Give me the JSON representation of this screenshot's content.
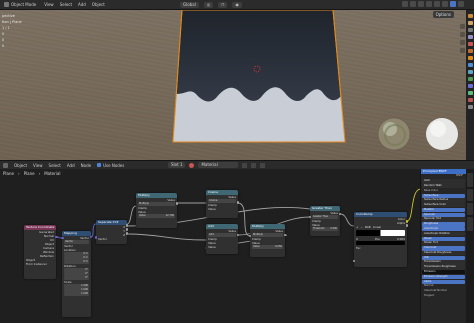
{
  "viewport_header": {
    "mode": "Object Mode",
    "menu": [
      "View",
      "Select",
      "Add",
      "Object"
    ],
    "orientation": "Global"
  },
  "viewport": {
    "overlay_lines": [
      "pective",
      "tion | Plane",
      "",
      "1 / 1",
      "0",
      "0",
      "0"
    ],
    "options_label": "Options"
  },
  "node_header": {
    "editor": "Object",
    "menu": [
      "View",
      "Select",
      "Add",
      "Node"
    ],
    "use_nodes_label": "Use Nodes",
    "slot": "Slot 1",
    "material": "Material"
  },
  "breadcrumb": [
    "Plane",
    "Plane",
    "Material"
  ],
  "nodes": {
    "texcoord": {
      "title": "Texture Coordinate",
      "outputs": [
        "Generated",
        "Normal",
        "UV",
        "Object",
        "Camera",
        "Window",
        "Reflection"
      ],
      "object_label": "Object",
      "from_instancer": "From Instancer"
    },
    "mapping": {
      "title": "Mapping",
      "type": "Vector",
      "vector": "Vector",
      "rows": [
        "Location",
        "X",
        "Y",
        "Z",
        "Rotation",
        "X",
        "Y",
        "Z",
        "Scale",
        "X",
        "Y",
        "Z"
      ],
      "loc_values": [
        "0 m",
        "0 m",
        "0 m"
      ],
      "rot_values": [
        "0°",
        "0°",
        "0°"
      ],
      "scale_values": [
        "1.000",
        "1.000",
        "1.000"
      ]
    },
    "separate": {
      "title": "Separate XYZ",
      "outputs": [
        "X",
        "Y",
        "Z"
      ],
      "input": "Vector"
    },
    "multiply1": {
      "title": "Multiply",
      "output": "Value",
      "op": "Multiply",
      "clamp": "Clamp",
      "value_label": "Value",
      "value": "12.700"
    },
    "cosine": {
      "title": "Cosine",
      "output": "Value",
      "op": "Cosine",
      "clamp": "Clamp",
      "value_label": "Value"
    },
    "add": {
      "title": "Add",
      "output": "Value",
      "op": "Add",
      "clamp": "Clamp",
      "value_label": "Value"
    },
    "multiply2": {
      "title": "Multiply",
      "output": "Value",
      "op": "Multiply",
      "clamp": "Clamp",
      "value_label": "Value",
      "value": "0.050"
    },
    "greater": {
      "title": "Greater Than",
      "output": "Value",
      "op": "Greater Than",
      "clamp": "Clamp",
      "value_label": "Value",
      "threshold": "Threshold",
      "threshold_value": "0.500"
    },
    "colorramp": {
      "title": "ColorRamp",
      "outputs": [
        "Color",
        "Alpha"
      ],
      "rgb": "RGB",
      "interp": "Linear",
      "pos_label": "Pos",
      "pos_value": "0.000",
      "index": "0",
      "input": "Fac"
    },
    "principled": {
      "title": "Principled BSDF",
      "output": "BSDF",
      "rows": [
        "GGX",
        "Random Walk",
        "Base Color",
        "Subsurface",
        "Subsurface Radius",
        "Subsurface Color",
        "Metallic",
        "Specular",
        "Specular Tint",
        "Roughness",
        "Anisotropic",
        "Anisotropic Rotation",
        "Sheen",
        "Sheen Tint",
        "Clearcoat",
        "Clearcoat Roughness",
        "IOR",
        "Transmission",
        "Transmission Roughness",
        "Emission",
        "Emission Strength",
        "Alpha",
        "Normal",
        "Clearcoat Normal",
        "Tangent"
      ]
    }
  },
  "colors": {
    "accent": "#4b74c4",
    "wood": "#776b5b",
    "plane_dark": "#2b323c",
    "plane_light": "#c9ced6",
    "selection_orange": "#e08a1e"
  }
}
